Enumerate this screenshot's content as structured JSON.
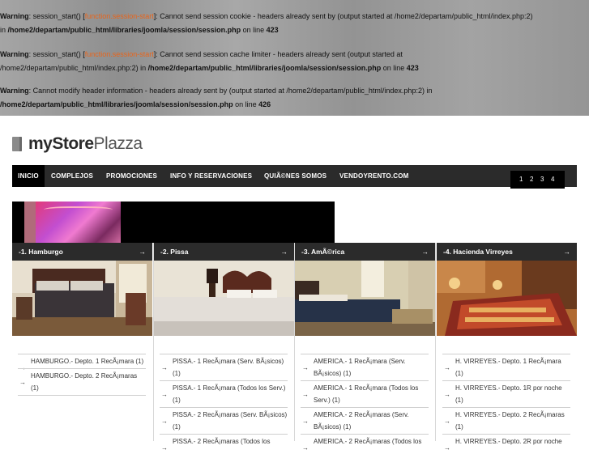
{
  "php_errors": [
    {
      "label": "Warning",
      "pre": ": session_start() [",
      "fn": "function.session-start",
      "mid1": "]: Cannot send session cookie - headers already sent by (output started at /home2/departam/public_html/index.php:2)",
      "l2pre": "in ",
      "path": "/home2/departam/public_html/libraries/joomla/session/session.php",
      "l2post": " on line ",
      "line": "423"
    },
    {
      "label": "Warning",
      "pre": ": session_start() [",
      "fn": "function.session-start",
      "mid1": "]: Cannot send session cache limiter - headers already sent (output started at",
      "l2pre": "/home2/departam/public_html/index.php:2) in ",
      "path": "/home2/departam/public_html/libraries/joomla/session/session.php",
      "l2post": " on line ",
      "line": "423"
    },
    {
      "label": "Warning",
      "pre": ": Cannot modify header information - headers already sent by (output started at /home2/departam/public_html/index.php:2) in",
      "fn": "",
      "mid1": "",
      "l2pre": "",
      "path": "/home2/departam/public_html/libraries/joomla/session/session.php",
      "l2post": " on line ",
      "line": "426"
    }
  ],
  "logo": {
    "part1": "myStore",
    "part2": "Plazza"
  },
  "nav": [
    "INICIO",
    "COMPLEJOS",
    "PROMOCIONES",
    "INFO Y RESERVACIONES",
    "QUIÃ©NES SOMOS",
    "VENDOYRENTO.COM"
  ],
  "pager": [
    "1",
    "2",
    "3",
    "4"
  ],
  "columns": [
    {
      "title": "-1. Hamburgo",
      "arrow": "→",
      "items": [
        "HAMBURGO.- Depto. 1 RecÃ¡mara (1)",
        "HAMBURGO.- Depto. 2 RecÃ¡maras (1)"
      ]
    },
    {
      "title": "-2. Pissa",
      "arrow": "→",
      "items": [
        "PISSA.- 1 RecÃ¡mara (Serv. BÃ¡sicos) (1)",
        "PISSA.- 1 RecÃ¡mara (Todos los Serv.) (1)",
        "PISSA.- 2 RecÃ¡maras (Serv. BÃ¡sicos) (1)",
        "PISSA.- 2 RecÃ¡maras (Todos los"
      ]
    },
    {
      "title": "-3. AmÃ©rica",
      "arrow": "→",
      "items": [
        "AMERICA.- 1 RecÃ¡mara (Serv. BÃ¡sicos) (1)",
        "AMERICA.- 1 RecÃ¡mara (Todos los Serv.) (1)",
        "AMERICA.- 2 RecÃ¡maras (Serv. BÃ¡sicos) (1)",
        "AMERICA.- 2 RecÃ¡maras (Todos los"
      ]
    },
    {
      "title": "-4. Hacienda Virreyes",
      "arrow": "→",
      "items": [
        "H. VIRREYES.- Depto. 1 RecÃ¡mara (1)",
        "H. VIRREYES.- Depto. 1R por noche (1)",
        "H. VIRREYES.- Depto. 2 RecÃ¡maras (1)",
        "H. VIRREYES.- Depto. 2R por noche"
      ]
    }
  ]
}
